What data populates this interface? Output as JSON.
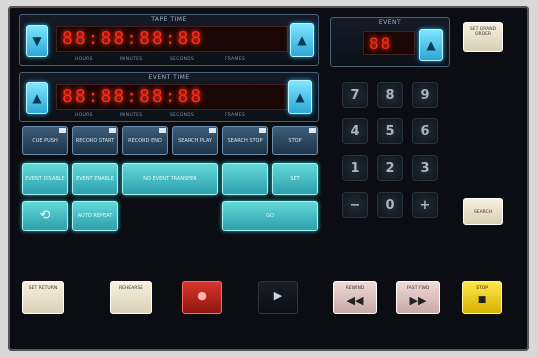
{
  "tape_time": {
    "title": "TAPE TIME",
    "display": "88:88:88:88",
    "sub_labels": [
      "HOURS",
      "MINUTES",
      "SECONDS",
      "FRAMES"
    ]
  },
  "event_time": {
    "title": "EVENT TIME",
    "display": "88:88:88:88",
    "sub_labels": [
      "HOURS",
      "MINUTES",
      "SECONDS",
      "FRAMES"
    ]
  },
  "top_right_panel": {
    "title": "EVENT",
    "display": "88"
  },
  "top_right_button": "SET GRAND ORDER",
  "function_row": [
    "CUE PUSH",
    "RECORD START",
    "RECORD END",
    "SEARCH PLAY",
    "SEARCH STOP",
    "STOP"
  ],
  "teal_buttons": {
    "event_disable": "EVENT DISABLE",
    "event_enable": "EVENT ENABLE",
    "transfer": "NO EVENT TRANSFER",
    "blank": "",
    "set": "SET",
    "auto_repeat": "AUTO REPEAT",
    "bottom_wide": "GO"
  },
  "keypad": [
    "7",
    "8",
    "9",
    "4",
    "5",
    "6",
    "1",
    "2",
    "3",
    "−",
    "0",
    "+"
  ],
  "search_button": "SEARCH",
  "transport": {
    "set_return": "SET RETURN",
    "rehearse": "REHEARSE",
    "record": "",
    "play": "",
    "rewind": "REWIND",
    "fast_fwd": "FAST FWD",
    "stop": "STOP"
  },
  "colors": {
    "led": "#ff2a1a",
    "cyan": "#2ca7d6",
    "teal": "#2d9fae",
    "yellow": "#ffe84a",
    "red": "#d7352b"
  }
}
